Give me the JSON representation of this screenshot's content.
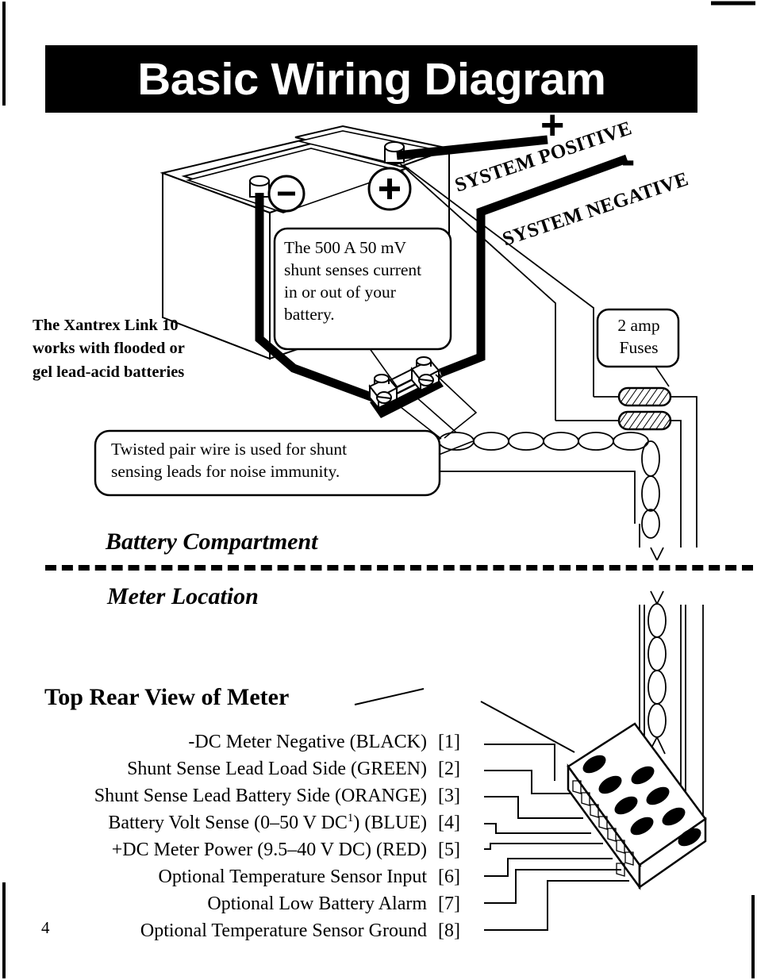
{
  "title": "Basic Wiring Diagram",
  "page_number": "4",
  "callouts": {
    "shunt": {
      "line1": "The 500 A 50 mV",
      "line2": "shunt senses current",
      "line3": "in or out of your",
      "line4": "battery."
    },
    "twisted_pair": {
      "line1": "Twisted pair wire is used for shunt",
      "line2": "sensing leads for noise immunity."
    },
    "fuses": {
      "line1": "2 amp",
      "line2": "Fuses"
    }
  },
  "xantrex_note": {
    "line1": "The Xantrex Link 10",
    "line2": "works with flooded or",
    "line3": "gel lead-acid batteries"
  },
  "system_labels": {
    "positive": "SYSTEM POSITIVE",
    "negative": "SYSTEM NEGATIVE",
    "positive_symbol": "+",
    "negative_symbol": "-"
  },
  "battery_terminals": {
    "negative_symbol": "–",
    "positive_symbol": "+"
  },
  "sections": {
    "battery_compartment": "Battery Compartment",
    "meter_location": "Meter Location",
    "top_rear_view": "Top Rear View of Meter"
  },
  "pins": [
    {
      "label": "-DC Meter Negative (BLACK)",
      "number": "[1]"
    },
    {
      "label": "Shunt Sense Lead Load Side (GREEN)",
      "number": "[2]"
    },
    {
      "label": "Shunt Sense Lead Battery Side (ORANGE)",
      "number": "[3]"
    },
    {
      "label": "Battery Volt Sense (0–50 V DC",
      "label_sup": "1",
      "label_tail": ") (BLUE)",
      "number": "[4]"
    },
    {
      "label": "+DC Meter Power (9.5–40 V DC) (RED)",
      "number": "[5]"
    },
    {
      "label": "Optional Temperature Sensor Input",
      "number": "[6]"
    },
    {
      "label": "Optional Low Battery Alarm",
      "number": "[7]"
    },
    {
      "label": "Optional Temperature Sensor Ground",
      "number": "[8]"
    }
  ],
  "colors": {
    "ink": "#000000",
    "paper": "#ffffff"
  }
}
